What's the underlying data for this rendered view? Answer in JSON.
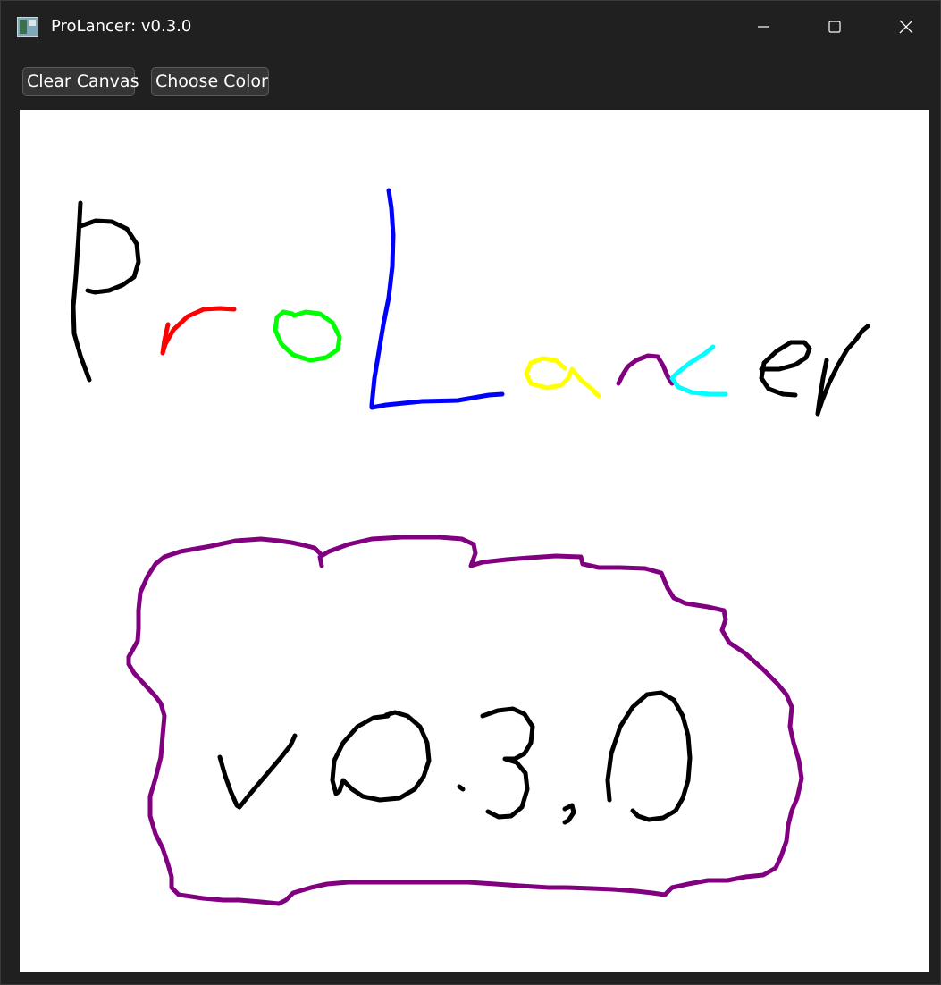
{
  "window": {
    "title": "ProLancer: v0.3.0"
  },
  "toolbar": {
    "clear_label": "Clear Canvas",
    "color_label": "Choose Color"
  },
  "canvas": {
    "background": "#ffffff",
    "stroke_colors": [
      "#000000",
      "#ff0000",
      "#00ff00",
      "#0000ff",
      "#ffff00",
      "#800080",
      "#00ffff"
    ],
    "drawing_text": [
      "ProLancer",
      "v0.3.0"
    ]
  },
  "icons": {
    "app": "app-window-icon",
    "minimize": "minimize-icon",
    "maximize": "maximize-icon",
    "close": "close-icon"
  }
}
